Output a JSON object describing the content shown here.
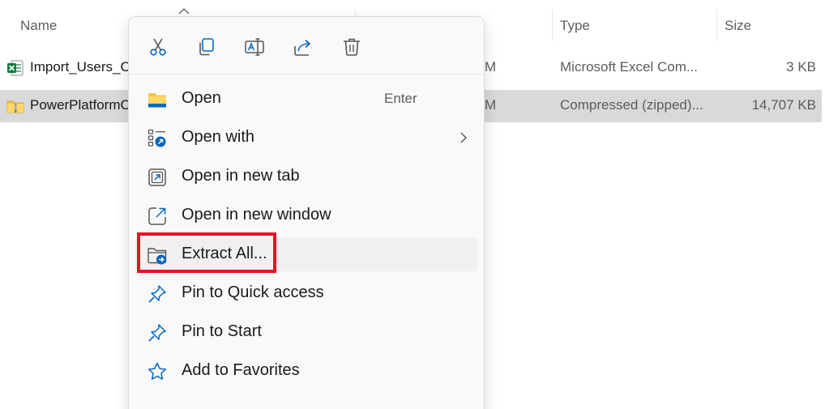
{
  "columns": {
    "name": "Name",
    "type": "Type",
    "size": "Size"
  },
  "files": [
    {
      "name": "Import_Users_C",
      "date_fragment": "M",
      "type": "Microsoft Excel Com...",
      "size": "3 KB",
      "icon": "excel-file-icon",
      "selected": false
    },
    {
      "name": "PowerPlatformC",
      "date_fragment": "M",
      "type": "Compressed (zipped)...",
      "size": "14,707 KB",
      "icon": "zip-folder-icon",
      "selected": true
    }
  ],
  "context_menu": {
    "quick_actions": [
      "cut-icon",
      "copy-icon",
      "rename-icon",
      "share-icon",
      "delete-icon"
    ],
    "items": [
      {
        "label": "Open",
        "shortcut": "Enter",
        "icon": "folder-icon"
      },
      {
        "label": "Open with",
        "icon": "open-with-icon",
        "submenu": true
      },
      {
        "label": "Open in new tab",
        "icon": "new-tab-icon"
      },
      {
        "label": "Open in new window",
        "icon": "new-window-icon"
      },
      {
        "label": "Extract All...",
        "icon": "extract-icon",
        "highlighted": true
      },
      {
        "label": "Pin to Quick access",
        "icon": "pin-icon"
      },
      {
        "label": "Pin to Start",
        "icon": "pin-icon"
      },
      {
        "label": "Add to Favorites",
        "icon": "star-icon"
      }
    ]
  },
  "colors": {
    "accent": "#0067c0",
    "selection": "#d9d9d9",
    "highlight_border": "#e81123",
    "excel_green": "#107c41",
    "folder_yellow": "#f4c542"
  }
}
